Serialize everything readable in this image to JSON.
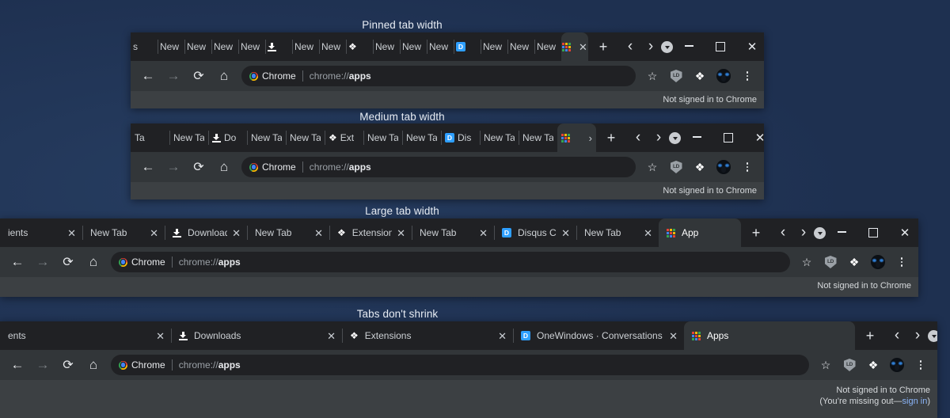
{
  "colors": {
    "wallpaper": "#22395c",
    "tabstrip_bg": "#202124",
    "toolbar_bg": "#323639",
    "content_bg": "#3c4043",
    "active_tab": "#323639",
    "link": "#8ab4f8",
    "disqus_blue": "#2e9fff",
    "apps_grid": [
      "#ea4335",
      "#fbbc05",
      "#34a853",
      "#4285f4",
      "#ea4335",
      "#fbbc05",
      "#34a853",
      "#4285f4",
      "#ea4335"
    ]
  },
  "toolbar": {
    "back_icon": "back-arrow-icon",
    "forward_icon": "forward-arrow-icon",
    "reload_icon": "reload-icon",
    "home_icon": "home-icon",
    "chip_label": "Chrome",
    "url_prefix": "chrome://",
    "url_bold": "apps",
    "url_full": "chrome://apps",
    "bookmark_icon": "star-icon",
    "shield_label": "LD",
    "extensions_icon": "puzzle-piece-icon",
    "avatar_icon": "profile-avatar",
    "menu_icon": "three-dot-menu-icon"
  },
  "strip_buttons": {
    "new_tab": "+",
    "prev": "‹",
    "next": "›",
    "tab_search": "tab-search-icon"
  },
  "window_controls": {
    "minimize": "minimize-button",
    "maximize": "maximize-button",
    "close": "✕"
  },
  "status": {
    "line1": "Not signed in to Chrome",
    "line2_prefix": "(You’re missing out—",
    "line2_link": "sign in",
    "line2_suffix": ")"
  },
  "panels": [
    {
      "caption": "Pinned tab width",
      "tab_width": 34,
      "show_close_on_tabs": false,
      "tabs": [
        {
          "title": "s",
          "favicon": "none",
          "partial": true
        },
        {
          "title": "New",
          "favicon": "none"
        },
        {
          "title": "New",
          "favicon": "none"
        },
        {
          "title": "New",
          "favicon": "none"
        },
        {
          "title": "New",
          "favicon": "none"
        },
        {
          "title": "",
          "favicon": "download"
        },
        {
          "title": "New",
          "favicon": "none"
        },
        {
          "title": "New",
          "favicon": "none"
        },
        {
          "title": "",
          "favicon": "puzzle"
        },
        {
          "title": "New",
          "favicon": "none"
        },
        {
          "title": "New",
          "favicon": "none"
        },
        {
          "title": "New",
          "favicon": "none"
        },
        {
          "title": "",
          "favicon": "disqus"
        },
        {
          "title": "New",
          "favicon": "none"
        },
        {
          "title": "New",
          "favicon": "none"
        },
        {
          "title": "New",
          "favicon": "none"
        },
        {
          "title": "",
          "favicon": "apps",
          "active": true,
          "close": "✕"
        }
      ]
    },
    {
      "caption": "Medium tab width",
      "tab_width": 49,
      "show_close_on_tabs": false,
      "tabs": [
        {
          "title": "Ta",
          "favicon": "none",
          "partial": true
        },
        {
          "title": "New Ta",
          "favicon": "none"
        },
        {
          "title": "Do",
          "favicon": "download"
        },
        {
          "title": "New Ta",
          "favicon": "none"
        },
        {
          "title": "New Ta",
          "favicon": "none"
        },
        {
          "title": "Ext",
          "favicon": "puzzle"
        },
        {
          "title": "New Ta",
          "favicon": "none"
        },
        {
          "title": "New Ta",
          "favicon": "none"
        },
        {
          "title": "Dis",
          "favicon": "disqus"
        },
        {
          "title": "New Ta",
          "favicon": "none"
        },
        {
          "title": "New Ta",
          "favicon": "none"
        },
        {
          "title": "",
          "favicon": "apps",
          "active": true,
          "close": "›"
        }
      ]
    },
    {
      "caption": "Large tab width",
      "tab_width": 104,
      "show_close_on_tabs": true,
      "tabs": [
        {
          "title": "ients",
          "favicon": "none",
          "partial": true,
          "close": "✕"
        },
        {
          "title": "New Tab",
          "favicon": "none",
          "close": "✕"
        },
        {
          "title": "Downloads",
          "favicon": "download",
          "close": "✕"
        },
        {
          "title": "New Tab",
          "favicon": "none",
          "close": "✕"
        },
        {
          "title": "Extensions",
          "favicon": "puzzle",
          "close": "✕"
        },
        {
          "title": "New Tab",
          "favicon": "none",
          "close": "✕"
        },
        {
          "title": "Disqus Con",
          "favicon": "disqus",
          "close": "✕"
        },
        {
          "title": "New Tab",
          "favicon": "none",
          "close": "✕"
        },
        {
          "title": "App",
          "favicon": "apps",
          "active": true
        }
      ]
    },
    {
      "caption": "Tabs don't shrink",
      "tab_width": 216,
      "show_close_on_tabs": true,
      "tabs": [
        {
          "title": "ents",
          "favicon": "none",
          "partial": true,
          "close": "✕"
        },
        {
          "title": "Downloads",
          "favicon": "download",
          "close": "✕"
        },
        {
          "title": "Extensions",
          "favicon": "puzzle",
          "close": "✕"
        },
        {
          "title": "OneWindows · Conversations · D",
          "favicon": "disqus",
          "close": "✕"
        },
        {
          "title": "Apps",
          "favicon": "apps",
          "active": true
        }
      ]
    }
  ]
}
